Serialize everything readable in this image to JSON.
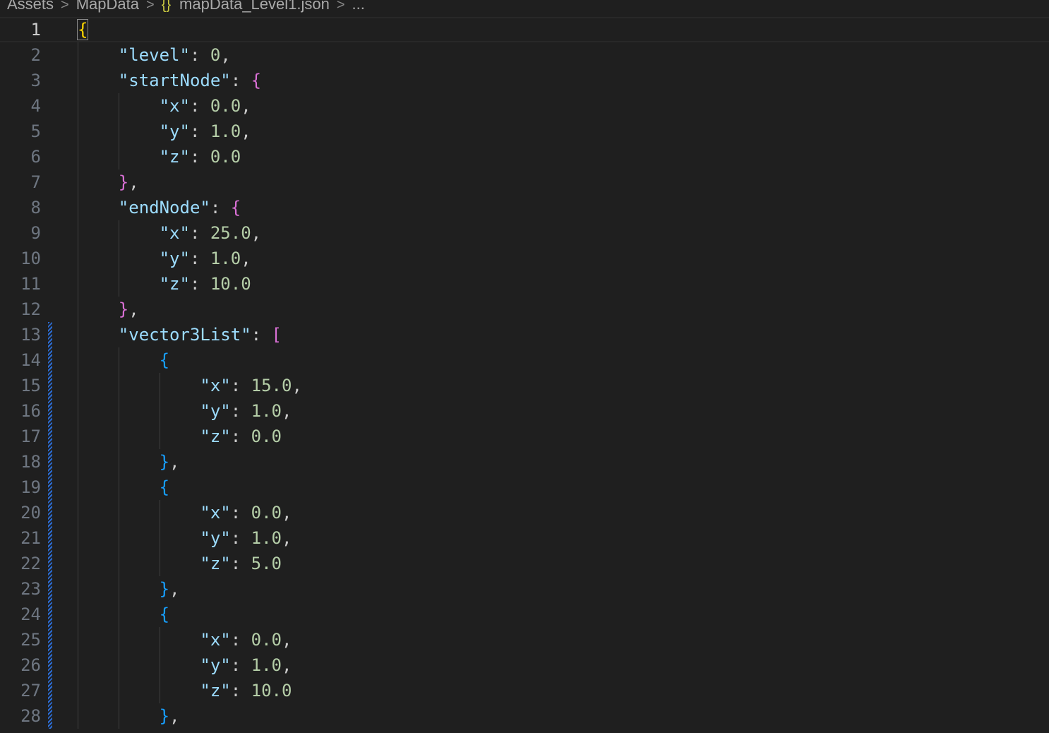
{
  "breadcrumb": {
    "segments": [
      "Assets",
      "MapData"
    ],
    "file_icon": "{}",
    "file_name": "mapData_Level1.json",
    "ellipsis": "..."
  },
  "editor": {
    "current_line": 1,
    "lines": [
      {
        "n": "1",
        "tokens": [
          [
            "b1",
            "{"
          ]
        ]
      },
      {
        "n": "2",
        "tokens": [
          [
            "sp",
            "    "
          ],
          [
            "k",
            "\"level\""
          ],
          [
            "p",
            ": "
          ],
          [
            "n",
            "0"
          ],
          [
            "p",
            ","
          ]
        ]
      },
      {
        "n": "3",
        "tokens": [
          [
            "sp",
            "    "
          ],
          [
            "k",
            "\"startNode\""
          ],
          [
            "p",
            ": "
          ],
          [
            "b2",
            "{"
          ]
        ]
      },
      {
        "n": "4",
        "tokens": [
          [
            "sp",
            "        "
          ],
          [
            "k",
            "\"x\""
          ],
          [
            "p",
            ": "
          ],
          [
            "n",
            "0.0"
          ],
          [
            "p",
            ","
          ]
        ]
      },
      {
        "n": "5",
        "tokens": [
          [
            "sp",
            "        "
          ],
          [
            "k",
            "\"y\""
          ],
          [
            "p",
            ": "
          ],
          [
            "n",
            "1.0"
          ],
          [
            "p",
            ","
          ]
        ]
      },
      {
        "n": "6",
        "tokens": [
          [
            "sp",
            "        "
          ],
          [
            "k",
            "\"z\""
          ],
          [
            "p",
            ": "
          ],
          [
            "n",
            "0.0"
          ]
        ]
      },
      {
        "n": "7",
        "tokens": [
          [
            "sp",
            "    "
          ],
          [
            "b2",
            "}"
          ],
          [
            "p",
            ","
          ]
        ]
      },
      {
        "n": "8",
        "tokens": [
          [
            "sp",
            "    "
          ],
          [
            "k",
            "\"endNode\""
          ],
          [
            "p",
            ": "
          ],
          [
            "b2",
            "{"
          ]
        ]
      },
      {
        "n": "9",
        "tokens": [
          [
            "sp",
            "        "
          ],
          [
            "k",
            "\"x\""
          ],
          [
            "p",
            ": "
          ],
          [
            "n",
            "25.0"
          ],
          [
            "p",
            ","
          ]
        ]
      },
      {
        "n": "10",
        "tokens": [
          [
            "sp",
            "        "
          ],
          [
            "k",
            "\"y\""
          ],
          [
            "p",
            ": "
          ],
          [
            "n",
            "1.0"
          ],
          [
            "p",
            ","
          ]
        ]
      },
      {
        "n": "11",
        "tokens": [
          [
            "sp",
            "        "
          ],
          [
            "k",
            "\"z\""
          ],
          [
            "p",
            ": "
          ],
          [
            "n",
            "10.0"
          ]
        ]
      },
      {
        "n": "12",
        "tokens": [
          [
            "sp",
            "    "
          ],
          [
            "b2",
            "}"
          ],
          [
            "p",
            ","
          ]
        ]
      },
      {
        "n": "13",
        "tokens": [
          [
            "sp",
            "    "
          ],
          [
            "k",
            "\"vector3List\""
          ],
          [
            "p",
            ": "
          ],
          [
            "b2",
            "["
          ]
        ]
      },
      {
        "n": "14",
        "tokens": [
          [
            "sp",
            "        "
          ],
          [
            "b3",
            "{"
          ]
        ]
      },
      {
        "n": "15",
        "tokens": [
          [
            "sp",
            "            "
          ],
          [
            "k",
            "\"x\""
          ],
          [
            "p",
            ": "
          ],
          [
            "n",
            "15.0"
          ],
          [
            "p",
            ","
          ]
        ]
      },
      {
        "n": "16",
        "tokens": [
          [
            "sp",
            "            "
          ],
          [
            "k",
            "\"y\""
          ],
          [
            "p",
            ": "
          ],
          [
            "n",
            "1.0"
          ],
          [
            "p",
            ","
          ]
        ]
      },
      {
        "n": "17",
        "tokens": [
          [
            "sp",
            "            "
          ],
          [
            "k",
            "\"z\""
          ],
          [
            "p",
            ": "
          ],
          [
            "n",
            "0.0"
          ]
        ]
      },
      {
        "n": "18",
        "tokens": [
          [
            "sp",
            "        "
          ],
          [
            "b3",
            "}"
          ],
          [
            "p",
            ","
          ]
        ]
      },
      {
        "n": "19",
        "tokens": [
          [
            "sp",
            "        "
          ],
          [
            "b3",
            "{"
          ]
        ]
      },
      {
        "n": "20",
        "tokens": [
          [
            "sp",
            "            "
          ],
          [
            "k",
            "\"x\""
          ],
          [
            "p",
            ": "
          ],
          [
            "n",
            "0.0"
          ],
          [
            "p",
            ","
          ]
        ]
      },
      {
        "n": "21",
        "tokens": [
          [
            "sp",
            "            "
          ],
          [
            "k",
            "\"y\""
          ],
          [
            "p",
            ": "
          ],
          [
            "n",
            "1.0"
          ],
          [
            "p",
            ","
          ]
        ]
      },
      {
        "n": "22",
        "tokens": [
          [
            "sp",
            "            "
          ],
          [
            "k",
            "\"z\""
          ],
          [
            "p",
            ": "
          ],
          [
            "n",
            "5.0"
          ]
        ]
      },
      {
        "n": "23",
        "tokens": [
          [
            "sp",
            "        "
          ],
          [
            "b3",
            "}"
          ],
          [
            "p",
            ","
          ]
        ]
      },
      {
        "n": "24",
        "tokens": [
          [
            "sp",
            "        "
          ],
          [
            "b3",
            "{"
          ]
        ]
      },
      {
        "n": "25",
        "tokens": [
          [
            "sp",
            "            "
          ],
          [
            "k",
            "\"x\""
          ],
          [
            "p",
            ": "
          ],
          [
            "n",
            "0.0"
          ],
          [
            "p",
            ","
          ]
        ]
      },
      {
        "n": "26",
        "tokens": [
          [
            "sp",
            "            "
          ],
          [
            "k",
            "\"y\""
          ],
          [
            "p",
            ": "
          ],
          [
            "n",
            "1.0"
          ],
          [
            "p",
            ","
          ]
        ]
      },
      {
        "n": "27",
        "tokens": [
          [
            "sp",
            "            "
          ],
          [
            "k",
            "\"z\""
          ],
          [
            "p",
            ": "
          ],
          [
            "n",
            "10.0"
          ]
        ]
      },
      {
        "n": "28",
        "tokens": [
          [
            "sp",
            "        "
          ],
          [
            "b3",
            "}"
          ],
          [
            "p",
            ","
          ]
        ]
      }
    ]
  }
}
